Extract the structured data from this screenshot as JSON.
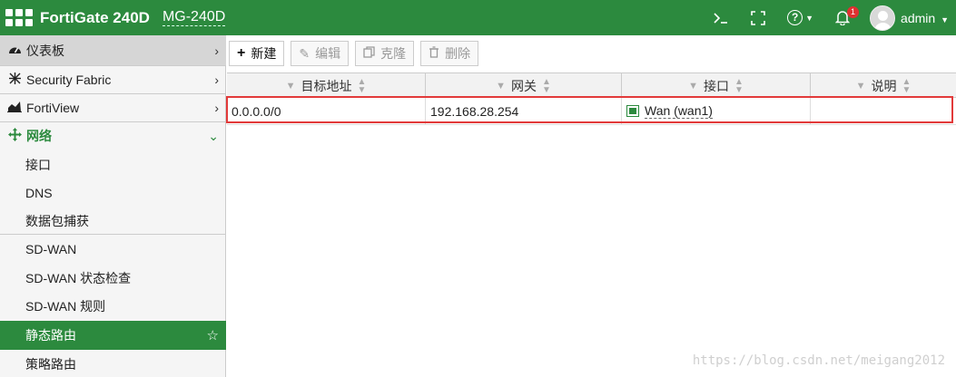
{
  "header": {
    "brand": "FortiGate 240D",
    "hostname": "MG-240D",
    "icons": [
      "terminal-icon",
      "fullscreen-icon",
      "help-icon",
      "bell-icon",
      "avatar"
    ],
    "help_symbol": "?",
    "notification_count": "1",
    "user": "admin"
  },
  "sidebar": {
    "items": [
      {
        "label": "仪表板",
        "icon": "dashboard-icon"
      },
      {
        "label": "Security Fabric",
        "icon": "fabric-icon"
      },
      {
        "label": "FortiView",
        "icon": "chart-icon"
      },
      {
        "label": "网络",
        "icon": "network-icon"
      },
      {
        "label": "接口"
      },
      {
        "label": "DNS"
      },
      {
        "label": "数据包捕获"
      },
      {
        "label": "SD-WAN"
      },
      {
        "label": "SD-WAN 状态检查"
      },
      {
        "label": "SD-WAN 规则"
      },
      {
        "label": "静态路由"
      },
      {
        "label": "策略路由"
      }
    ]
  },
  "toolbar": {
    "new_label": "新建",
    "edit_label": "编辑",
    "clone_label": "克隆",
    "delete_label": "删除"
  },
  "table": {
    "columns": [
      "目标地址",
      "网关",
      "接口",
      "说明"
    ],
    "rows": [
      {
        "destination": "0.0.0.0/0",
        "gateway": "192.168.28.254",
        "interface": "Wan (wan1)",
        "comment": ""
      }
    ]
  },
  "watermark": "https://blog.csdn.net/meigang2012",
  "colors": {
    "brand_green": "#2c8a3e",
    "highlight_red": "#e23a3a",
    "badge_red": "#e03030"
  }
}
